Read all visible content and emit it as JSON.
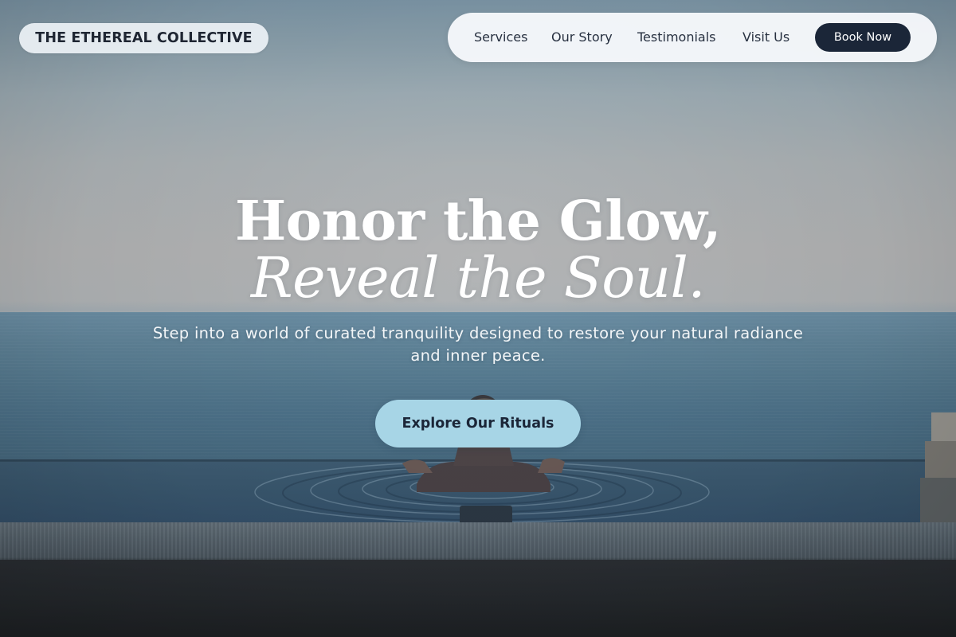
{
  "brand": {
    "name": "THE ETHEREAL COLLECTIVE"
  },
  "nav": {
    "links": [
      {
        "label": "Services"
      },
      {
        "label": "Our Story"
      },
      {
        "label": "Testimonials"
      },
      {
        "label": "Visit Us"
      }
    ],
    "cta_label": "Book Now"
  },
  "hero": {
    "headline_line1": "Honor the Glow,",
    "headline_line2": "Reveal the Soul.",
    "subheadline": "Step into a world of curated tranquility designed to restore your natural radiance and inner peace.",
    "cta_label": "Explore Our Rituals"
  },
  "colors": {
    "dark_navy": "#1b2638",
    "cta_light_blue": "#a7d5e6",
    "nav_background": "#f6f8fb",
    "text_white": "#ffffff"
  }
}
